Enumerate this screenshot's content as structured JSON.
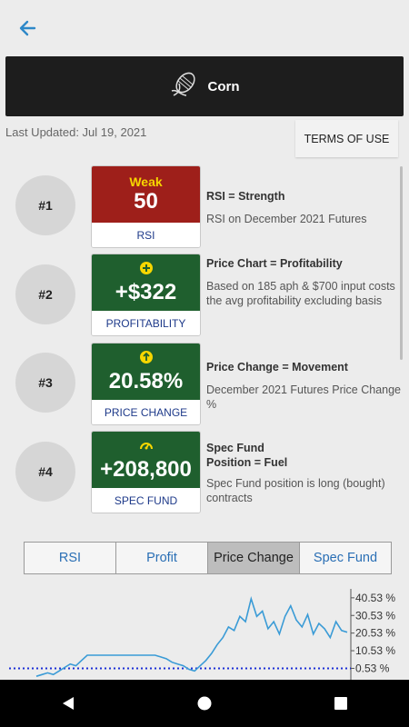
{
  "header": {
    "title": "Corn",
    "icon": "corn-icon"
  },
  "last_updated": "Last Updated: Jul 19, 2021",
  "terms_label": "TERMS OF USE",
  "indicators": [
    {
      "rank": "#1",
      "sub": "Weak",
      "value": "50",
      "label": "RSI",
      "color": "#9e1f1a",
      "title": "RSI = Strength",
      "desc": "RSI on December 2021 Futures"
    },
    {
      "rank": "#2",
      "sub": "",
      "value": "+$322",
      "label": "PROFITABILITY",
      "color": "#1f5f2e",
      "icon": "plus-circle-icon",
      "title": "Price Chart = Profitability",
      "desc": "Based on 185 aph & $700 input costs the avg profitability excluding basis"
    },
    {
      "rank": "#3",
      "sub": "",
      "value": "20.58%",
      "label": "PRICE CHANGE",
      "color": "#1f5f2e",
      "icon": "arrow-up-circle-icon",
      "title": "Price Change = Movement",
      "desc": "December 2021 Futures Price Change %"
    },
    {
      "rank": "#4",
      "sub": "",
      "value": "+208,800",
      "label": "SPEC FUND",
      "color": "#1f5f2e",
      "icon": "gauge-icon",
      "title": "Spec Fund\nPosition = Fuel",
      "desc": "Spec Fund position is long (bought) contracts"
    }
  ],
  "tabs": [
    "RSI",
    "Profit",
    "Price Change",
    "Spec Fund"
  ],
  "active_tab": "Price Change",
  "chart_data": {
    "type": "line",
    "y_tick_labels": [
      "40.53 %",
      "30.53 %",
      "20.53 %",
      "10.53 %",
      "0.53 %"
    ],
    "y_ticks": [
      40.53,
      30.53,
      20.53,
      10.53,
      0.53
    ],
    "ylim": [
      -5,
      42
    ],
    "reference_line": 0.53,
    "series": [
      {
        "color": "#3a9bd6",
        "values": [
          -4,
          -3,
          -2,
          -3,
          -1,
          1,
          3,
          2,
          5,
          8,
          8,
          8,
          8,
          8,
          8,
          8,
          8,
          8,
          8,
          8,
          8,
          8,
          7,
          6,
          4,
          3,
          2,
          0,
          -1,
          2,
          5,
          9,
          14,
          18,
          24,
          22,
          30,
          27,
          40,
          30,
          33,
          23,
          27,
          20,
          30,
          36,
          28,
          24,
          31,
          20,
          26,
          23,
          18,
          27,
          22,
          21
        ]
      }
    ],
    "reference_color": "#1d2fd6"
  },
  "nav": {
    "back": "back-triangle-icon",
    "home": "home-circle-icon",
    "recents": "recents-square-icon"
  }
}
